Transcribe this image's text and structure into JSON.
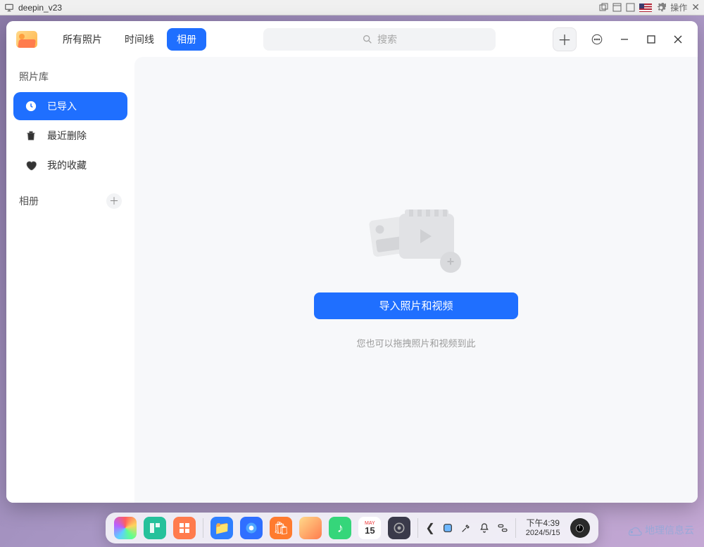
{
  "vm": {
    "title": "deepin_v23",
    "action_label": "操作"
  },
  "toolbar": {
    "tabs": [
      "所有照片",
      "时间线",
      "相册"
    ],
    "active_tab_index": 2,
    "search_placeholder": "搜索"
  },
  "sidebar": {
    "library_title": "照片库",
    "items": [
      {
        "label": "已导入",
        "icon": "clock"
      },
      {
        "label": "最近删除",
        "icon": "trash"
      },
      {
        "label": "我的收藏",
        "icon": "heart"
      }
    ],
    "active_index": 0,
    "album_section_title": "相册"
  },
  "content": {
    "import_button": "导入照片和视频",
    "hint": "您也可以拖拽照片和视频到此"
  },
  "dock": {
    "time1": "下午4:39",
    "time2": "2024/5/15",
    "calendar_month": "MAY",
    "calendar_day": "15"
  },
  "watermark": "地理信息云"
}
